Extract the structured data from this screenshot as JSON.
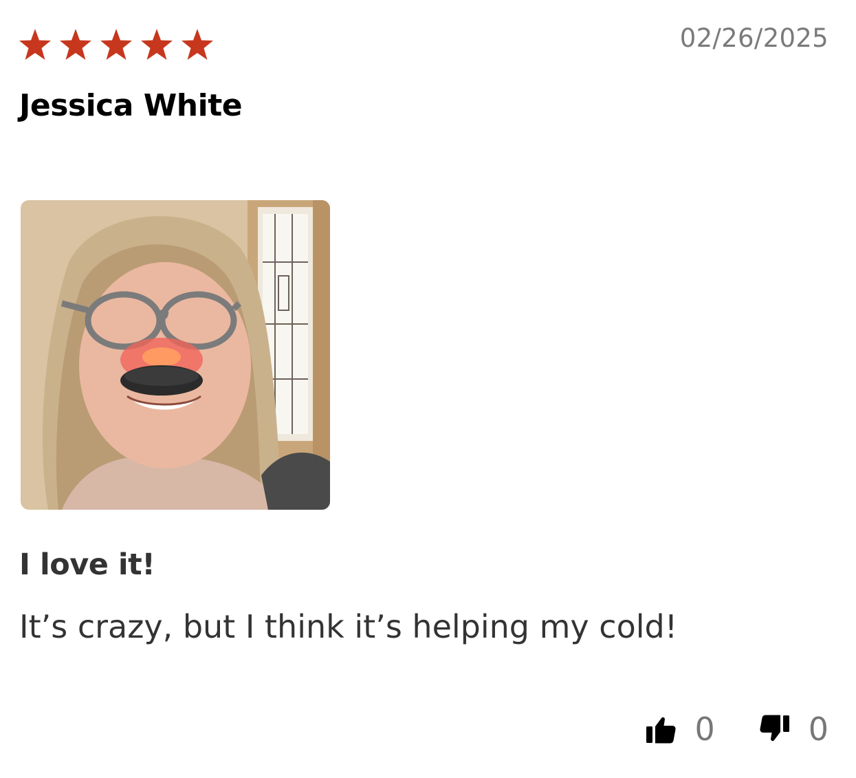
{
  "review": {
    "rating": 5,
    "rating_max": 5,
    "star_color": "#c7371d",
    "date": "02/26/2025",
    "author": "Jessica White",
    "photo": {
      "description_icon": "review-photo"
    },
    "title": "I love it!",
    "body": "It’s crazy, but I think it’s helping my cold!",
    "helpful": {
      "up_icon": "thumbs-up-icon",
      "up_count": "0",
      "down_icon": "thumbs-down-icon",
      "down_count": "0"
    }
  }
}
